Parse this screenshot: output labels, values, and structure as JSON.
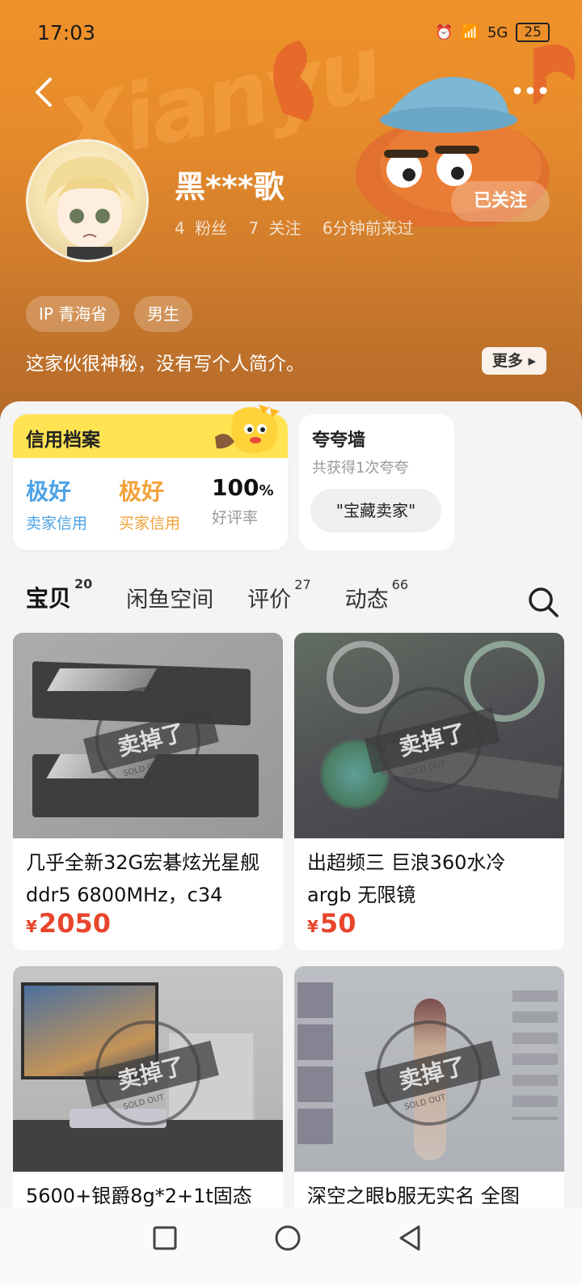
{
  "status_bar": {
    "time": "17:03",
    "battery": "25",
    "network": "5G"
  },
  "header": {
    "brand_watermark": "Xianyu",
    "username": "黑***歌",
    "stats": [
      "4 粉丝",
      "7 关注",
      "6分钟前来过"
    ],
    "follow_label": "已关注",
    "tags": [
      "IP 青海省",
      "男生"
    ],
    "bio": "这家伙很神秘，没有写个人简介。",
    "more_label": "更多"
  },
  "credit": {
    "title": "信用档案",
    "seller": {
      "value": "极好",
      "label": "卖家信用",
      "color": "#4da3e6"
    },
    "buyer": {
      "value": "极好",
      "label": "买家信用",
      "color": "#f2a23a"
    },
    "rating": {
      "value": "100",
      "unit": "%",
      "label": "好评率"
    }
  },
  "praise": {
    "title": "夸夸墙",
    "subtitle": "共获得1次夸夸",
    "badge": "\"宝藏卖家\""
  },
  "tabs": [
    {
      "label": "宝贝",
      "count": "20",
      "active": true
    },
    {
      "label": "闲鱼空间",
      "count": ""
    },
    {
      "label": "评价",
      "count": "27"
    },
    {
      "label": "动态",
      "count": "66"
    }
  ],
  "sold_stamp": {
    "text": "卖掉了",
    "sub": "SOLD OUT",
    "ring": "XIANYU"
  },
  "products": [
    {
      "title": "几乎全新32G宏碁炫光星舰ddr5 6800MHz，c34",
      "currency": "¥",
      "price": "2050"
    },
    {
      "title": "出超频三 巨浪360水冷 argb 无限镜",
      "currency": "¥",
      "price": "50"
    },
    {
      "title": "5600+银爵8g*2+1t固态",
      "currency": "",
      "price": ""
    },
    {
      "title": "深空之眼b服无实名 全图",
      "currency": "",
      "price": ""
    }
  ],
  "icons": {
    "back": "back-arrow-icon",
    "more": "more-dots-icon",
    "search": "search-icon"
  },
  "colors": {
    "accent_yellow": "#ffe352",
    "price_red": "#e8452c",
    "header_orange": "#e58a2c"
  }
}
